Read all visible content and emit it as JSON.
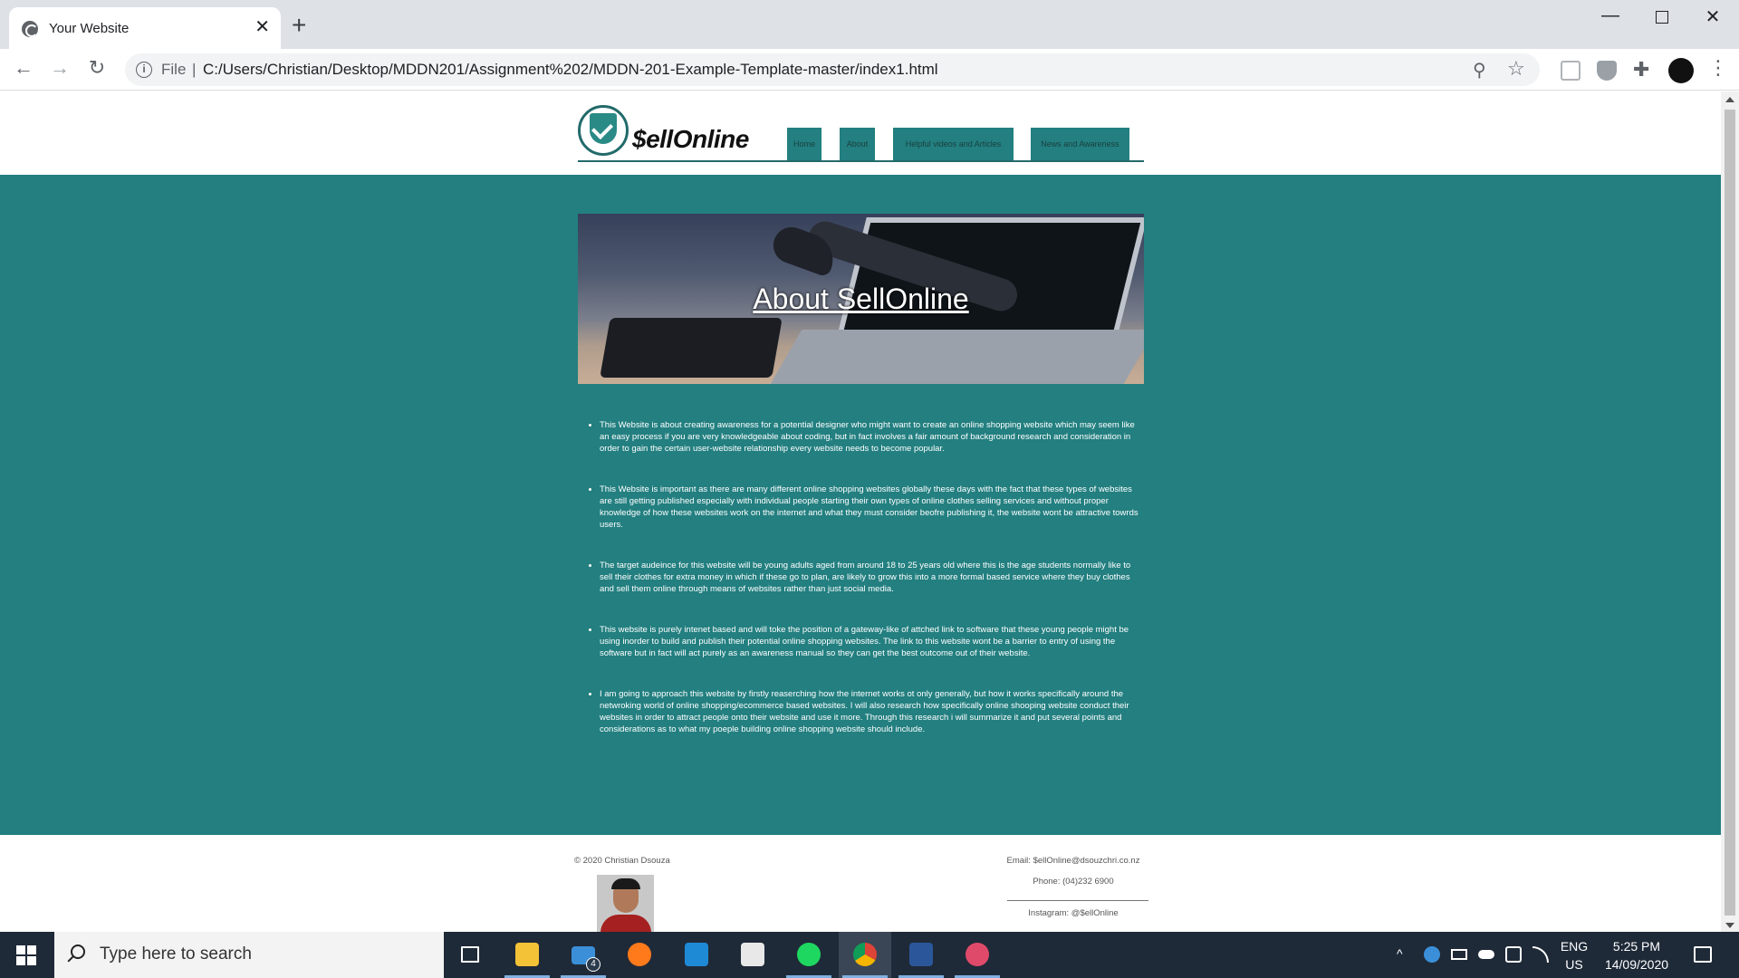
{
  "browser": {
    "tab_title": "Your Website",
    "tab_close": "✕",
    "new_tab": "+",
    "window": {
      "minimize": "—",
      "close": "✕"
    },
    "nav": {
      "back": "←",
      "forward": "→",
      "reload": "↻"
    },
    "address": {
      "info": "i",
      "scheme": "File",
      "separator": "|",
      "url": "C:/Users/Christian/Desktop/MDDN201/Assignment%202/MDDN-201-Example-Template-master/index1.html"
    },
    "zoom_icon": "⚲",
    "star_icon": "☆",
    "extensions_icon": "✚",
    "menu": "⋮"
  },
  "site": {
    "logo_text": "$ellOnline",
    "nav": {
      "home": "Home",
      "about": "About",
      "videos": "Helpful videos and Articles",
      "news": "News and Awareness"
    },
    "banner_title": "About SellOnline",
    "paragraphs": [
      "This Website is about creating awareness for a potential designer who might want to create an online shopping website which may seem like an easy process if you are very knowledgeable about coding, but in fact involves a fair amount of background research and consideration in order to gain the certain user-website relationship every website needs to become popular.",
      "This Website is important as there are many different online shopping websites globally these days with the fact that these types of websites are still getting published especially with individual people starting their own types of online clothes selling services and without proper knowledge of how these websites work on the internet and what they must consider beofre publishing it, the website wont be attractive towrds users.",
      "The target audeince for this website will be young adults aged from around 18 to 25 years old where this is the age students normally like to sell their clothes for extra money in which if these go to plan, are likely to grow this into a more formal based service where they buy clothes and sell them online through means of websites rather than just social media.",
      "This website is purely intenet based and will toke the position of a gateway-like of attched link to software that these young people might be using inorder to build and publish their potential online shopping websites. The link to this website wont be a barrier to entry of using the software but in fact will act purely as an awareness manual so they can get the best outcome out of their website.",
      "I am going to approach this website by firstly reaserching how the internet works ot only generally, but how it works specifically around the netwroking world of online shopping/ecommerce based websites. I will also research how specifically online shooping website conduct their websites in order to attract people onto their website and use it more. Through this research i will summarize it and put several points and considerations as to what my poeple building online shopping website should include."
    ],
    "footer": {
      "copyright": "© 2020 Christian Dsouza",
      "email": "Email: $ellOnline@dsouzchri.co.nz",
      "phone": "Phone: (04)232 6900",
      "instagram": "Instagram: @$ellOnline"
    }
  },
  "taskbar": {
    "search_placeholder": "Type here to search",
    "mail_badge": "4",
    "lang_line1": "ENG",
    "lang_line2": "US",
    "time": "5:25 PM",
    "date": "14/09/2020"
  },
  "colors": {
    "teal": "#237f80",
    "nav_teal": "#237f80",
    "taskbar": "#1f2a38"
  }
}
